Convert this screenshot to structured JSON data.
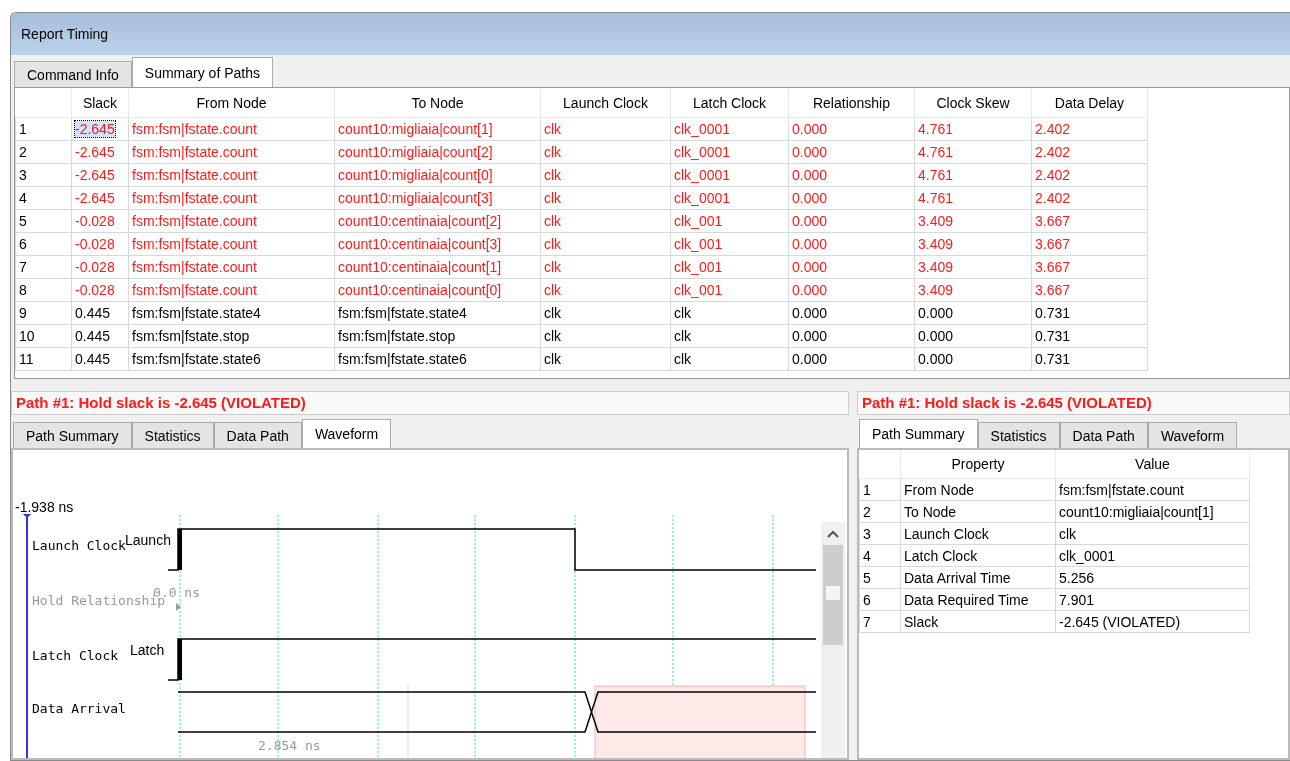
{
  "window": {
    "title": "Report Timing"
  },
  "tabs": [
    {
      "label": "Command Info",
      "selected": false
    },
    {
      "label": "Summary of Paths",
      "selected": true
    }
  ],
  "paths_table": {
    "columns": [
      "Slack",
      "From Node",
      "To Node",
      "Launch Clock",
      "Latch Clock",
      "Relationship",
      "Clock Skew",
      "Data Delay"
    ],
    "rows": [
      {
        "index": "1",
        "violated": true,
        "selected": true,
        "cells": [
          "-2.645",
          "fsm:fsm|fstate.count",
          "count10:migliaia|count[1]",
          "clk",
          "clk_0001",
          "0.000",
          "4.761",
          "2.402"
        ]
      },
      {
        "index": "2",
        "violated": true,
        "selected": false,
        "cells": [
          "-2.645",
          "fsm:fsm|fstate.count",
          "count10:migliaia|count[2]",
          "clk",
          "clk_0001",
          "0.000",
          "4.761",
          "2.402"
        ]
      },
      {
        "index": "3",
        "violated": true,
        "selected": false,
        "cells": [
          "-2.645",
          "fsm:fsm|fstate.count",
          "count10:migliaia|count[0]",
          "clk",
          "clk_0001",
          "0.000",
          "4.761",
          "2.402"
        ]
      },
      {
        "index": "4",
        "violated": true,
        "selected": false,
        "cells": [
          "-2.645",
          "fsm:fsm|fstate.count",
          "count10:migliaia|count[3]",
          "clk",
          "clk_0001",
          "0.000",
          "4.761",
          "2.402"
        ]
      },
      {
        "index": "5",
        "violated": true,
        "selected": false,
        "cells": [
          "-0.028",
          "fsm:fsm|fstate.count",
          "count10:centinaia|count[2]",
          "clk",
          "clk_001",
          "0.000",
          "3.409",
          "3.667"
        ]
      },
      {
        "index": "6",
        "violated": true,
        "selected": false,
        "cells": [
          "-0.028",
          "fsm:fsm|fstate.count",
          "count10:centinaia|count[3]",
          "clk",
          "clk_001",
          "0.000",
          "3.409",
          "3.667"
        ]
      },
      {
        "index": "7",
        "violated": true,
        "selected": false,
        "cells": [
          "-0.028",
          "fsm:fsm|fstate.count",
          "count10:centinaia|count[1]",
          "clk",
          "clk_001",
          "0.000",
          "3.409",
          "3.667"
        ]
      },
      {
        "index": "8",
        "violated": true,
        "selected": false,
        "cells": [
          "-0.028",
          "fsm:fsm|fstate.count",
          "count10:centinaia|count[0]",
          "clk",
          "clk_001",
          "0.000",
          "3.409",
          "3.667"
        ]
      },
      {
        "index": "9",
        "violated": false,
        "selected": false,
        "cells": [
          "0.445",
          "fsm:fsm|fstate.state4",
          "fsm:fsm|fstate.state4",
          "clk",
          "clk",
          "0.000",
          "0.000",
          "0.731"
        ]
      },
      {
        "index": "10",
        "violated": false,
        "selected": false,
        "cells": [
          "0.445",
          "fsm:fsm|fstate.stop",
          "fsm:fsm|fstate.stop",
          "clk",
          "clk",
          "0.000",
          "0.000",
          "0.731"
        ]
      },
      {
        "index": "11",
        "violated": false,
        "selected": false,
        "cells": [
          "0.445",
          "fsm:fsm|fstate.state6",
          "fsm:fsm|fstate.state6",
          "clk",
          "clk",
          "0.000",
          "0.000",
          "0.731"
        ]
      }
    ]
  },
  "left_panel": {
    "heading": "Path #1: Hold slack is -2.645 (VIOLATED)",
    "tabs": [
      {
        "label": "Path Summary",
        "selected": false
      },
      {
        "label": "Statistics",
        "selected": false
      },
      {
        "label": "Data Path",
        "selected": false
      },
      {
        "label": "Waveform",
        "selected": true
      }
    ],
    "waveform": {
      "time_marker": "-1.938 ns",
      "bottom_annotation": "2.854 ns",
      "signals": [
        {
          "name": "Launch Clock",
          "kind": "launch",
          "tag": "Launch"
        },
        {
          "name": "Hold Relationship",
          "kind": "relationship",
          "tag": "0.0 ns"
        },
        {
          "name": "Latch Clock",
          "kind": "latch",
          "tag": "Latch"
        },
        {
          "name": "Data Arrival",
          "kind": "data"
        }
      ]
    }
  },
  "right_panel": {
    "heading": "Path #1: Hold slack is -2.645 (VIOLATED)",
    "tabs": [
      {
        "label": "Path Summary",
        "selected": true
      },
      {
        "label": "Statistics",
        "selected": false
      },
      {
        "label": "Data Path",
        "selected": false
      },
      {
        "label": "Waveform",
        "selected": false
      }
    ],
    "columns": [
      "Property",
      "Value"
    ],
    "rows": [
      {
        "index": "1",
        "property": "From Node",
        "value": "fsm:fsm|fstate.count"
      },
      {
        "index": "2",
        "property": "To Node",
        "value": "count10:migliaia|count[1]"
      },
      {
        "index": "3",
        "property": "Launch Clock",
        "value": "clk"
      },
      {
        "index": "4",
        "property": "Latch Clock",
        "value": "clk_0001"
      },
      {
        "index": "5",
        "property": "Data Arrival Time",
        "value": "5.256"
      },
      {
        "index": "6",
        "property": "Data Required Time",
        "value": "7.901"
      },
      {
        "index": "7",
        "property": "Slack",
        "value": "-2.645 (VIOLATED)"
      }
    ]
  }
}
